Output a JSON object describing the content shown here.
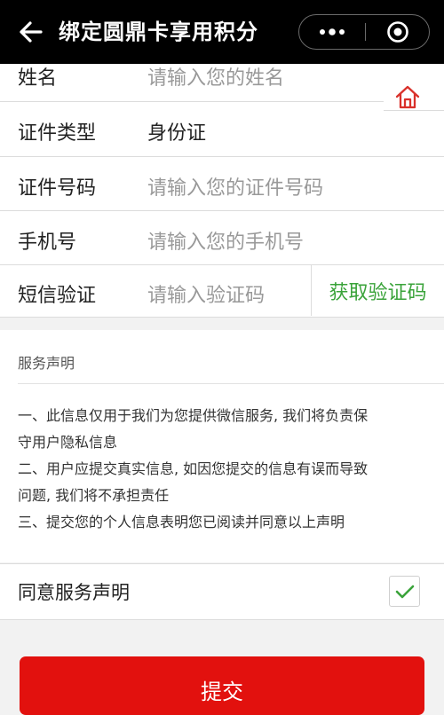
{
  "header": {
    "title": "绑定圆鼎卡享用积分",
    "back_icon": "arrow-left-icon",
    "more_icon": "more-dots-icon",
    "close_icon": "target-close-icon"
  },
  "form": {
    "name_label": "姓名",
    "name_placeholder": "请输入您的姓名",
    "id_type_label": "证件类型",
    "id_type_value": "身份证",
    "id_number_label": "证件号码",
    "id_number_placeholder": "请输入您的证件号码",
    "phone_label": "手机号",
    "phone_placeholder": "请输入您的手机号",
    "code_label": "短信验证",
    "code_placeholder": "请输入验证码",
    "get_code_label": "获取验证码",
    "home_icon": "home-icon"
  },
  "notice": {
    "title": "服务声明",
    "lines": [
      "一、此信息仅用于我们为您提供微信服务, 我们将负责保",
      "守用户隐私信息",
      "二、用户应提交真实信息, 如因您提交的信息有误而导致",
      "问题, 我们将不承担责任",
      "三、提交您的个人信息表明您已阅读并同意以上声明"
    ]
  },
  "agree": {
    "label": "同意服务声明",
    "checked": true
  },
  "submit_label": "提交",
  "colors": {
    "header_bg": "#000000",
    "accent_green": "#3aa33a",
    "submit_red": "#e2110e",
    "home_icon_red": "#d9312b"
  }
}
